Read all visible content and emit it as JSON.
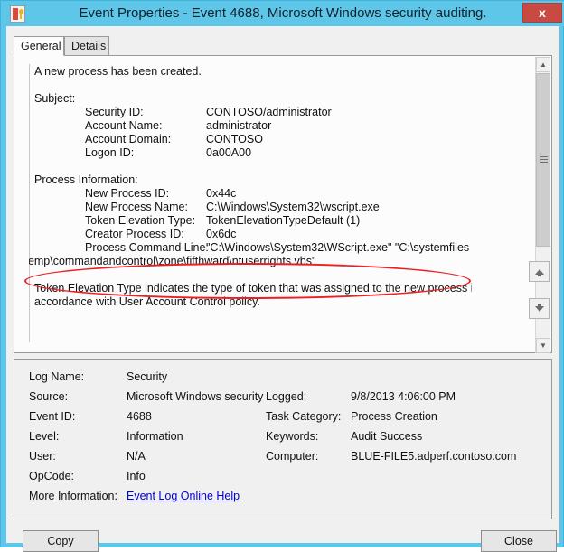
{
  "window": {
    "title": "Event Properties - Event 4688, Microsoft Windows security auditing.",
    "icon": "event-log-shield-key-icon",
    "close_glyph": "x",
    "accent_color": "#5ec6e8",
    "close_button_color": "#c94a42"
  },
  "tabs": [
    {
      "label": "General",
      "active": true
    },
    {
      "label": "Details",
      "active": false
    }
  ],
  "description": {
    "headline": "A new process has been created.",
    "sections": [
      {
        "heading": "Subject:",
        "rows": [
          {
            "label": "Security ID:",
            "value": "CONTOSO/administrator"
          },
          {
            "label": "Account Name:",
            "value": "administrator"
          },
          {
            "label": "Account Domain:",
            "value": "CONTOSO"
          },
          {
            "label": "Logon ID:",
            "value": "0a00A00"
          }
        ]
      },
      {
        "heading": "Process Information:",
        "rows": [
          {
            "label": "New Process ID:",
            "value": "0x44c"
          },
          {
            "label": "New Process Name:",
            "value": "C:\\Windows\\System32\\wscript.exe"
          },
          {
            "label": "Token Elevation Type:",
            "value": "TokenElevationTypeDefault (1)"
          },
          {
            "label": "Creator Process ID:",
            "value": "0x6dc"
          },
          {
            "label": "Process Command Line:",
            "value": "\"C:\\Windows\\System32\\WScript.exe\" \"C:\\systemfiles"
          }
        ]
      }
    ],
    "command_line_wrap": "\\temp\\commandandcontrol\\zone\\fifthward\\ntuserrights.vbs\"",
    "footnote_line1": "Token Elevation Type indicates the type of token that was assigned to the new process in",
    "footnote_line2": "accordance with User Account Control policy."
  },
  "annotation": {
    "shape": "ellipse",
    "color": "#ec2024",
    "target": "process-command-line"
  },
  "details": {
    "left": [
      {
        "label": "Log Name:",
        "value": "Security"
      },
      {
        "label": "Source:",
        "value": "Microsoft Windows security"
      },
      {
        "label": "Event ID:",
        "value": "4688"
      },
      {
        "label": "Level:",
        "value": "Information"
      },
      {
        "label": "User:",
        "value": "N/A"
      },
      {
        "label": "OpCode:",
        "value": "Info"
      }
    ],
    "right": [
      {
        "label": "Logged:",
        "value": "9/8/2013 4:06:00 PM"
      },
      {
        "label": "Task Category:",
        "value": "Process Creation"
      },
      {
        "label": "Keywords:",
        "value": "Audit Success"
      },
      {
        "label": "Computer:",
        "value": "BLUE-FILE5.adperf.contoso.com"
      }
    ],
    "more_information_label": "More Information:",
    "more_information_link": "Event Log Online Help"
  },
  "navigation": {
    "up_label": "Previous event",
    "down_label": "Next event"
  },
  "scrollbar": {
    "up_glyph": "▲",
    "down_glyph": "▼"
  },
  "footer": {
    "copy_label": "Copy",
    "close_label": "Close"
  }
}
